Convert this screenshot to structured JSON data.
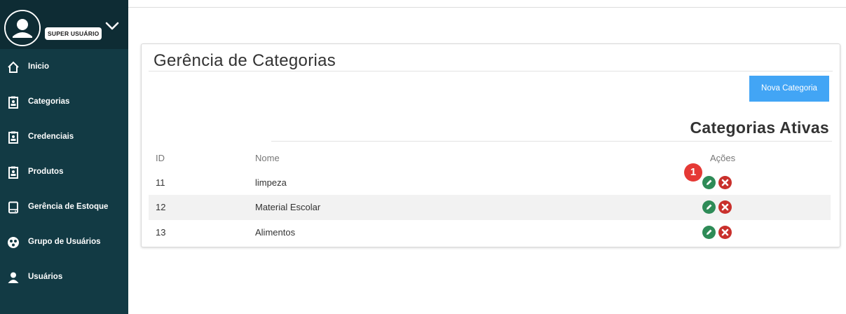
{
  "sidebar": {
    "role": "SUPER USUÁRIO",
    "items": [
      {
        "label": "Inicio",
        "icon": "home-icon"
      },
      {
        "label": "Categorias",
        "icon": "clipboard-icon"
      },
      {
        "label": "Credenciais",
        "icon": "clipboard-icon"
      },
      {
        "label": "Produtos",
        "icon": "clipboard-icon"
      },
      {
        "label": "Gerência de Estoque",
        "icon": "storage-icon"
      },
      {
        "label": "Grupo de Usuários",
        "icon": "group-icon"
      },
      {
        "label": "Usuários",
        "icon": "user-icon"
      }
    ]
  },
  "main": {
    "title": "Gerência de Categorias",
    "new_button": "Nova Categoria",
    "section_title": "Categorias Ativas",
    "table": {
      "headers": {
        "id": "ID",
        "name": "Nome",
        "actions": "Ações"
      },
      "rows": [
        {
          "id": "11",
          "name": "limpeza"
        },
        {
          "id": "12",
          "name": "Material Escolar"
        },
        {
          "id": "13",
          "name": "Alimentos"
        }
      ]
    },
    "annotation_marker": "1"
  },
  "colors": {
    "sidebar": "#123a44",
    "primary_button": "#42a5f5",
    "edit": "#2e8b57",
    "delete": "#c9302c",
    "marker": "#e53935"
  }
}
